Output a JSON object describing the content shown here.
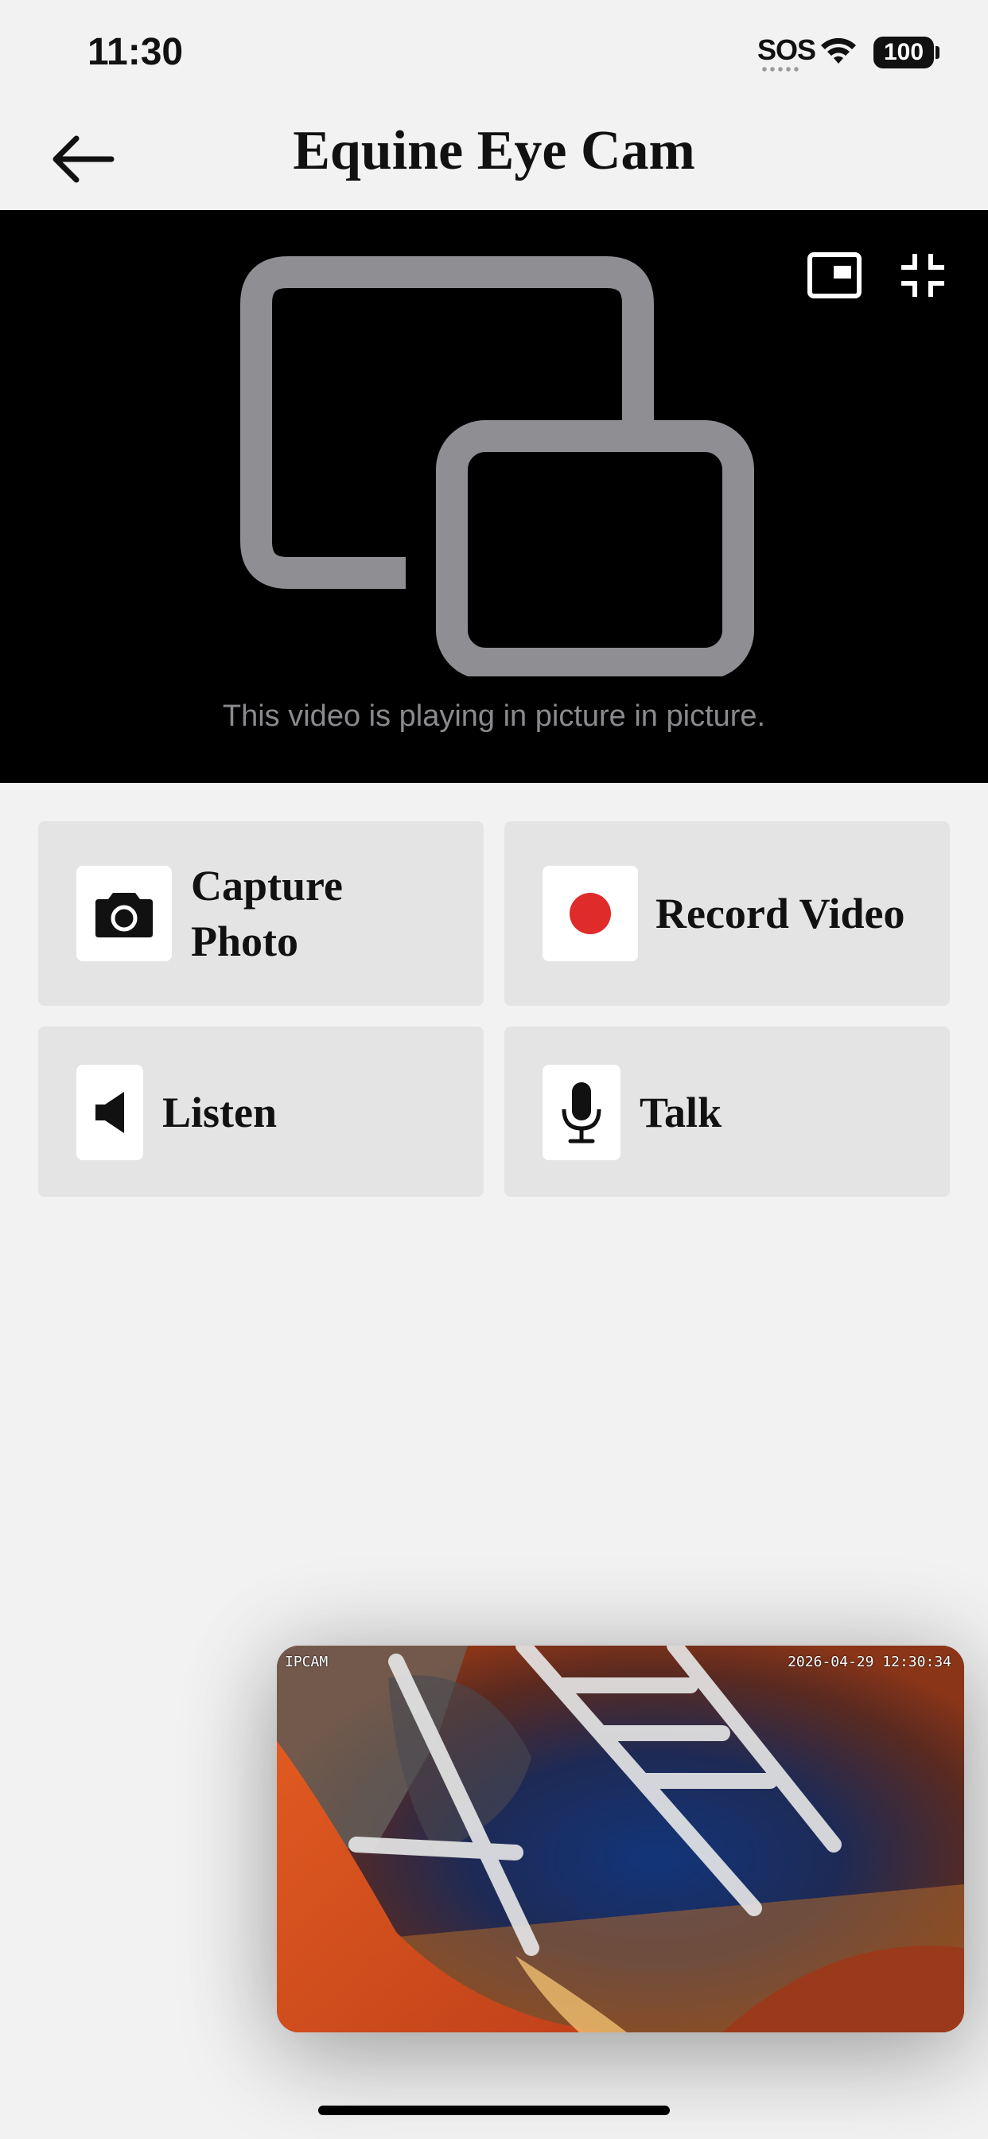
{
  "status_bar": {
    "time": "11:30",
    "sos": "SOS",
    "battery": "100",
    "wifi_icon": "wifi-icon"
  },
  "header": {
    "title": "Equine Eye Cam",
    "back_icon": "arrow-left-icon"
  },
  "video": {
    "message": "This video is playing in picture in picture.",
    "placeholder_icon": "picture-in-picture-icon",
    "pip_toggle_icon": "pip-icon",
    "exit_fullscreen_icon": "collapse-icon"
  },
  "actions": [
    {
      "label_line1": "Capture",
      "label_line2": "Photo",
      "icon": "camera-icon"
    },
    {
      "label": "Record Video",
      "icon": "record-dot-icon",
      "icon_color": "#e02b2b"
    },
    {
      "label": "Listen",
      "icon": "speaker-icon"
    },
    {
      "label": "Talk",
      "icon": "microphone-icon"
    }
  ],
  "pip_window": {
    "camera_label": "IPCAM",
    "timestamp": "2026-04-29 12:30:34"
  }
}
